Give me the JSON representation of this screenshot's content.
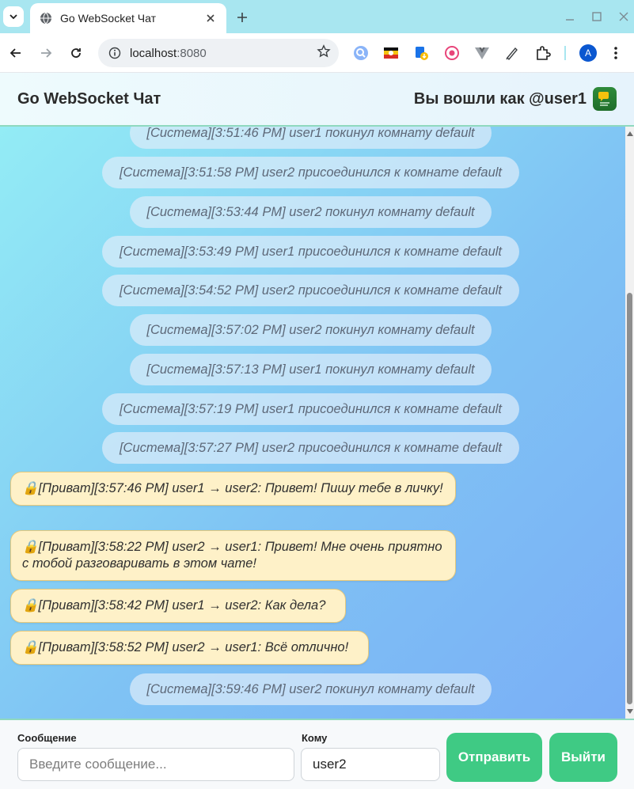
{
  "browser": {
    "tab_title": "Go WebSocket Чат",
    "url_host": "localhost",
    "url_port": ":8080",
    "profile_initial": "A"
  },
  "header": {
    "title": "Go WebSocket Чат",
    "user_label": "Вы вошли как @user1"
  },
  "messages": [
    {
      "type": "system",
      "text": "[Система][3:51:46 PM] user1 покинул комнату default"
    },
    {
      "type": "system",
      "text": "[Система][3:51:58 PM] user2 присоединился к комнате default"
    },
    {
      "type": "system",
      "text": "[Система][3:53:44 PM] user2 покинул комнату default"
    },
    {
      "type": "system",
      "text": "[Система][3:53:49 PM] user1 присоединился к комнате default"
    },
    {
      "type": "system",
      "text": "[Система][3:54:52 PM] user2 присоединился к комнате default"
    },
    {
      "type": "system",
      "text": "[Система][3:57:02 PM] user2 покинул комнату default"
    },
    {
      "type": "system",
      "text": "[Система][3:57:13 PM] user1 покинул комнату default"
    },
    {
      "type": "system",
      "text": "[Система][3:57:19 PM] user1 присоединился к комнате default"
    },
    {
      "type": "system",
      "text": "[Система][3:57:27 PM] user2 присоединился к комнате default"
    },
    {
      "type": "private",
      "icon": "lock-icon",
      "text": "[Приват][3:57:46 PM] user1 → user2: Привет! Пишу тебе в личку!"
    },
    {
      "type": "private",
      "icon": "lock-icon",
      "text": "[Приват][3:58:22 PM] user2 → user1: Привет! Мне очень приятно с тобой разговаривать в этом чате!"
    },
    {
      "type": "private",
      "icon": "lock-icon",
      "text": "[Приват][3:58:42 PM] user1 → user2: Как дела?"
    },
    {
      "type": "private",
      "icon": "lock-icon",
      "text": "[Приват][3:58:52 PM] user2 → user1: Всё отлично!"
    },
    {
      "type": "system",
      "text": "[Система][3:59:46 PM] user2 покинул комнату default"
    }
  ],
  "composer": {
    "message_label": "Сообщение",
    "message_placeholder": "Введите сообщение...",
    "message_value": "",
    "to_label": "Кому",
    "to_value": "user2",
    "send_label": "Отправить",
    "logout_label": "Выйти"
  },
  "colors": {
    "accent": "#3fca84",
    "private_bg": "#fef1c8",
    "private_border": "#e7c97a",
    "system_bg": "#dcecfa"
  }
}
